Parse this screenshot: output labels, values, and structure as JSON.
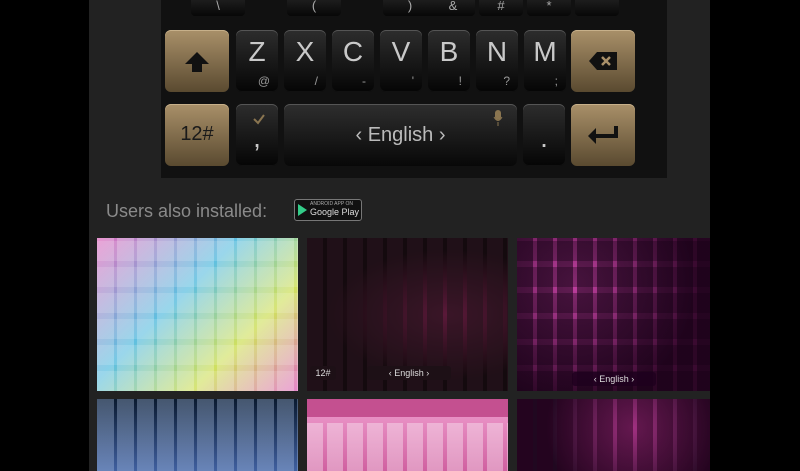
{
  "keyboard": {
    "top_row": [
      "\\",
      "(",
      ")",
      "&",
      "#",
      "*",
      ""
    ],
    "row_letters": [
      {
        "main": "Z",
        "sub": "@"
      },
      {
        "main": "X",
        "sub": "/"
      },
      {
        "main": "C",
        "sub": "-"
      },
      {
        "main": "V",
        "sub": "'"
      },
      {
        "main": "B",
        "sub": "!"
      },
      {
        "main": "N",
        "sub": "?"
      },
      {
        "main": "M",
        "sub": ";"
      }
    ],
    "shift_icon": "shift-arrow-up-icon",
    "backspace_icon": "backspace-icon",
    "num_key": "12#",
    "comma_key": ",",
    "space_label": "‹  English  ›",
    "period_key": ".",
    "enter_icon": "enter-return-icon",
    "accent_color": "#a99069"
  },
  "section": {
    "users_installed": "Users also installed:",
    "google_play_top": "ANDROID APP ON",
    "google_play": "Google Play"
  },
  "thumbnails": [
    {
      "name": "rainbow-keyboard-theme",
      "colors": [
        "#e070c0",
        "#60c0e0",
        "#d0e060"
      ]
    },
    {
      "name": "black-pink-keyboard-theme",
      "colors": [
        "#1a0d12",
        "#5a1a3a"
      ],
      "space_label": "‹ English ›",
      "num_key": "12#"
    },
    {
      "name": "pink-leopard-keyboard-theme",
      "colors": [
        "#3a0a30",
        "#c040a0"
      ],
      "space_label": "‹ English ›"
    },
    {
      "name": "blue-glass-keyboard-theme",
      "colors": [
        "#0a1a30",
        "#4060a0"
      ]
    },
    {
      "name": "pink-glossy-keyboard-theme",
      "colors": [
        "#d060a0",
        "#f0a0d0"
      ]
    },
    {
      "name": "purple-heart-keyboard-theme",
      "colors": [
        "#200820",
        "#a03080"
      ]
    }
  ]
}
